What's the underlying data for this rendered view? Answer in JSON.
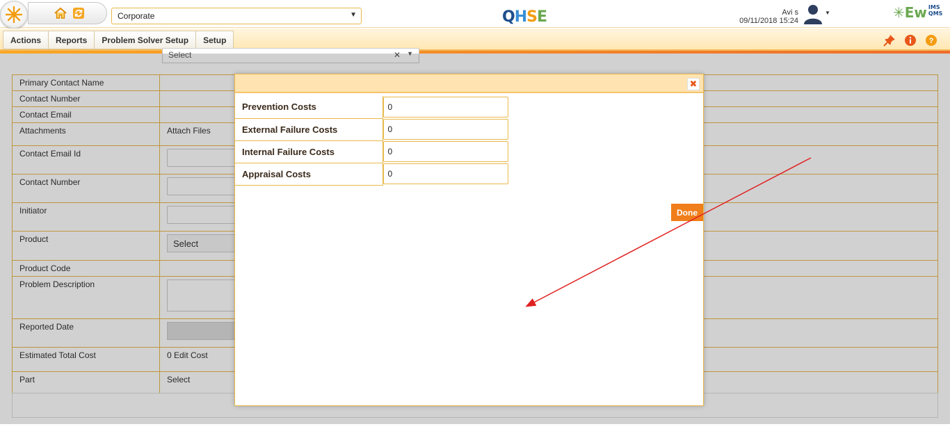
{
  "header": {
    "org_selected": "Corporate",
    "logo_q": "Q",
    "logo_h": "H",
    "logo_s": "S",
    "logo_e": "E",
    "user_name": "Avi s",
    "datetime": "09/11/2018 15:24",
    "brand_main": "Ew",
    "brand_ims": "IMS",
    "brand_qms": "QMS"
  },
  "nav": {
    "tabs": [
      {
        "label": "Actions"
      },
      {
        "label": "Reports"
      },
      {
        "label": "Problem Solver Setup"
      },
      {
        "label": "Setup"
      }
    ],
    "icons": [
      "pin-icon",
      "info-icon",
      "help-icon"
    ]
  },
  "form": {
    "top_select": "Select",
    "rows": [
      {
        "label": "Primary Contact Name"
      },
      {
        "label": "Contact Number"
      },
      {
        "label": "Contact Email"
      },
      {
        "label": "Attachments",
        "value": "Attach Files"
      },
      {
        "label": "Contact Email Id"
      },
      {
        "label": "Contact Number"
      },
      {
        "label": "Initiator"
      },
      {
        "label": "Product",
        "value": "Select"
      },
      {
        "label": "Product Code"
      },
      {
        "label": "Problem Description"
      },
      {
        "label": "Reported Date"
      },
      {
        "label": "Estimated Total Cost",
        "value": "0 Edit Cost"
      },
      {
        "label": "Part",
        "value": "Select"
      }
    ]
  },
  "modal": {
    "close_label": "✖",
    "costs": [
      {
        "label": "Prevention Costs",
        "value": "0"
      },
      {
        "label": "External Failure Costs",
        "value": "0"
      },
      {
        "label": "Internal Failure Costs",
        "value": "0"
      },
      {
        "label": "Appraisal Costs",
        "value": "0"
      }
    ],
    "done_label": "Done"
  },
  "colors": {
    "accent_orange": "#f07e1a",
    "border_gold": "#e8b84a",
    "header_cream": "#ffe3b0",
    "annotation_red": "#e02020"
  }
}
